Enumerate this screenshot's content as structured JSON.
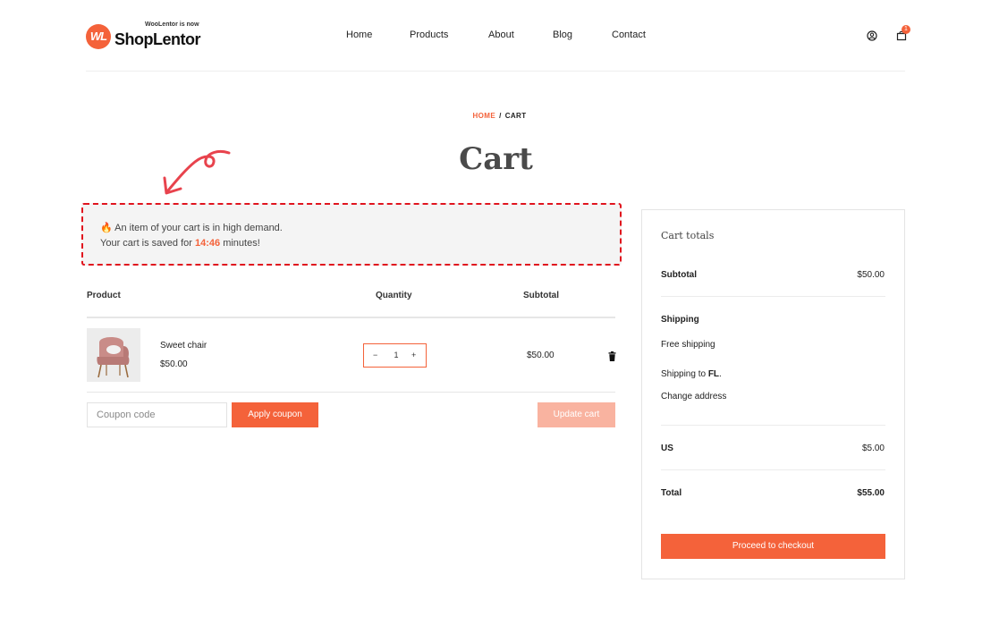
{
  "brand": {
    "tagline": "WooLentor is now",
    "name": "ShopLentor",
    "mark": "WL",
    "accent": "#f4623a"
  },
  "nav": {
    "items": [
      "Home",
      "Products",
      "About",
      "Blog",
      "Contact"
    ]
  },
  "header": {
    "cart_count": "1"
  },
  "breadcrumb": {
    "home": "HOME",
    "separator": "/",
    "current": "CART"
  },
  "page": {
    "title": "Cart"
  },
  "notice": {
    "emoji": "🔥",
    "line1": "An item of your cart is in high demand.",
    "line2_prefix": "Your cart is saved for",
    "timer": "14:46",
    "line2_suffix": "minutes!",
    "border_color": "#e0141e"
  },
  "table": {
    "headers": {
      "product": "Product",
      "quantity": "Quantity",
      "subtotal": "Subtotal"
    },
    "items": [
      {
        "name": "Sweet chair",
        "price": "$50.00",
        "quantity": "1",
        "subtotal": "$50.00"
      }
    ],
    "qty_minus": "−",
    "qty_plus": "+"
  },
  "coupon": {
    "placeholder": "Coupon code",
    "apply_label": "Apply coupon",
    "update_label": "Update cart"
  },
  "totals": {
    "title": "Cart totals",
    "subtotal_label": "Subtotal",
    "subtotal_value": "$50.00",
    "shipping_label": "Shipping",
    "shipping_method": "Free shipping",
    "shipping_to_prefix": "Shipping to",
    "shipping_to_region": "FL",
    "shipping_to_suffix": ".",
    "change_address": "Change address",
    "country_label": "US",
    "country_value": "$5.00",
    "total_label": "Total",
    "total_value": "$55.00",
    "checkout_label": "Proceed to checkout"
  }
}
